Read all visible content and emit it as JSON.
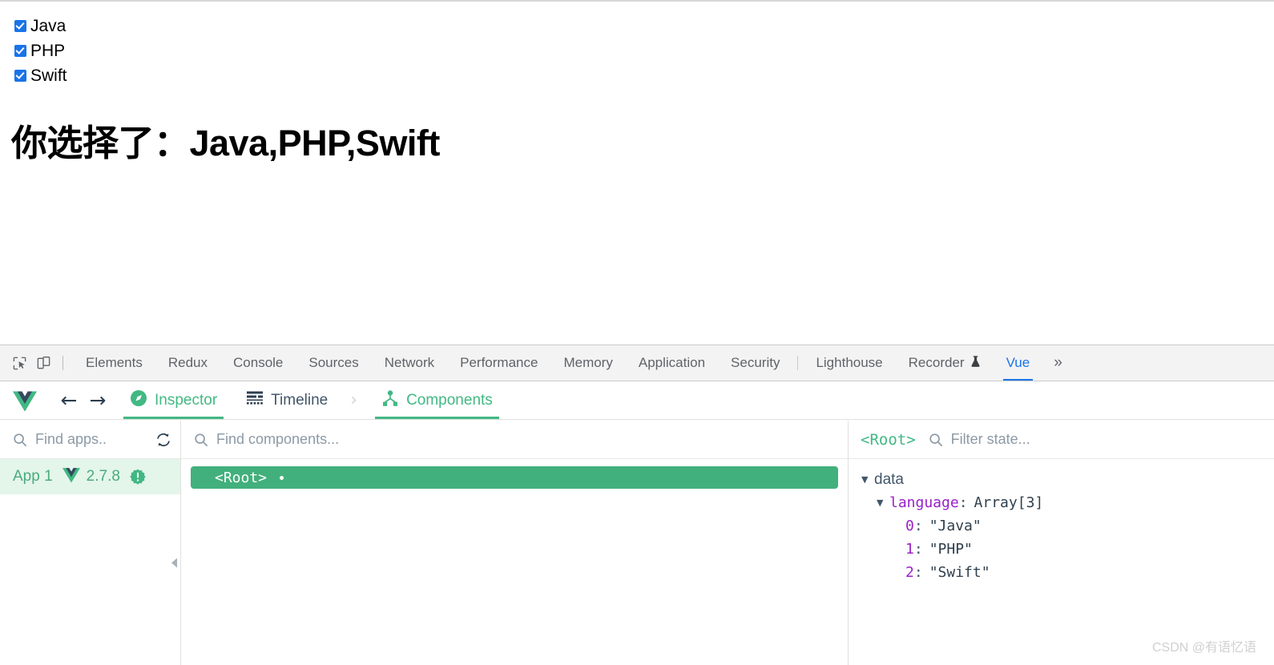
{
  "page": {
    "checkboxes": [
      {
        "label": "Java",
        "checked": true
      },
      {
        "label": "PHP",
        "checked": true
      },
      {
        "label": "Swift",
        "checked": true
      }
    ],
    "result_heading": "你选择了：Java,PHP,Swift"
  },
  "devtools": {
    "tabs": [
      {
        "label": "Elements",
        "active": false
      },
      {
        "label": "Redux",
        "active": false
      },
      {
        "label": "Console",
        "active": false
      },
      {
        "label": "Sources",
        "active": false
      },
      {
        "label": "Network",
        "active": false
      },
      {
        "label": "Performance",
        "active": false
      },
      {
        "label": "Memory",
        "active": false
      },
      {
        "label": "Application",
        "active": false
      },
      {
        "label": "Security",
        "active": false
      },
      {
        "label": "Lighthouse",
        "active": false
      },
      {
        "label": "Recorder",
        "active": false,
        "experimental": true
      },
      {
        "label": "Vue",
        "active": true
      }
    ],
    "more_label": "»",
    "recorder_flask": "⚗",
    "inspect_icon": "inspect-element-icon",
    "device_icon": "device-toolbar-icon"
  },
  "vue_toolbar": {
    "back_arrow": "←",
    "forward_arrow": "→",
    "chevron": "›",
    "items": [
      {
        "label": "Inspector",
        "icon": "compass-icon",
        "active": true
      },
      {
        "label": "Timeline",
        "icon": "timeline-icon",
        "active": false
      },
      {
        "label": "Components",
        "icon": "component-tree-icon",
        "active": true
      }
    ]
  },
  "apps_panel": {
    "search_placeholder": "Find apps..",
    "refresh_icon": "refresh-icon",
    "app": {
      "name": "App 1",
      "version": "2.7.8",
      "badge_icon": "warning-badge-icon"
    }
  },
  "tree_panel": {
    "search_placeholder": "Find components...",
    "nodes": [
      {
        "label": "<Root>",
        "selected": true,
        "has_dot": true
      }
    ]
  },
  "state_panel": {
    "component": "<Root>",
    "filter_placeholder": "Filter state...",
    "tree": {
      "group": "data",
      "property": "language",
      "type": "Array[3]",
      "items": [
        {
          "index": "0",
          "value": "\"Java\""
        },
        {
          "index": "1",
          "value": "\"PHP\""
        },
        {
          "index": "2",
          "value": "\"Swift\""
        }
      ]
    }
  },
  "watermark": "CSDN @有语忆语",
  "colors": {
    "vue_green": "#42b883",
    "chrome_blue": "#1a73e8",
    "checkbox_blue": "#1a73e8",
    "purple_key": "#9a20c9"
  }
}
